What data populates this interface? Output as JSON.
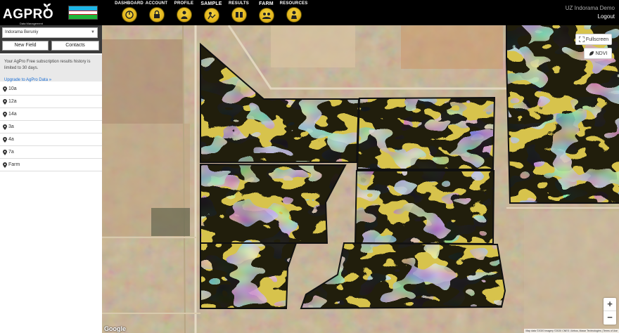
{
  "app": {
    "brand": "AGPRO",
    "brand_sub": "Data Management",
    "country_flag": "uzbekistan-flag"
  },
  "nav": [
    {
      "label": "DASHBOARD",
      "icon": "dashboard-icon"
    },
    {
      "label": "ACCOUNT",
      "icon": "lock-icon"
    },
    {
      "label": "PROFILE",
      "icon": "person-icon"
    },
    {
      "label": "SAMPLE",
      "icon": "sample-icon"
    },
    {
      "label": "RESULTS",
      "icon": "results-icon"
    },
    {
      "label": "FARM",
      "icon": "farm-icon"
    },
    {
      "label": "RESOURCES",
      "icon": "resources-icon"
    }
  ],
  "user": {
    "name": "UZ Indorama Demo",
    "logout_label": "Logout"
  },
  "sidebar": {
    "org_selected": "Indorama Beruniy",
    "new_field_label": "New Field",
    "contacts_label": "Contacts",
    "notice_text": "Your AgPro Free subscription results history is limited to 30 days.",
    "upgrade_link": "Upgrade to AgPro Data »",
    "fields": [
      "10a",
      "12a",
      "14a",
      "3a",
      "4a",
      "7a",
      "Farm"
    ]
  },
  "map": {
    "fullscreen_label": "Fullscreen",
    "layer_label": "NDVI",
    "zoom_in": "+",
    "zoom_out": "−",
    "google_label": "Google",
    "attribution": "Map data ©2020 Imagery ©2020 CNES / Airbus, Maxar Technologies | Terms of Use"
  },
  "colors": {
    "ndvi_low": "#d9b94a",
    "ndvi_mid": "#e6e84a",
    "ndvi_green": "#4cc464",
    "ndvi_high": "#3f5bbd",
    "ndvi_orange": "#e8955a",
    "link": "#1a6fd6"
  }
}
